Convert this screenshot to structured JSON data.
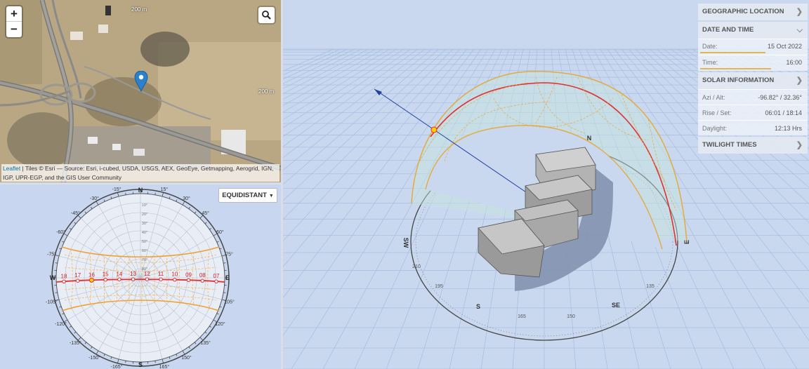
{
  "map": {
    "zoom_in_label": "+",
    "zoom_out_label": "−",
    "scale_labels": [
      "200 m",
      "200 m"
    ],
    "attribution_link": "Leaflet",
    "attribution_text": " | Tiles © Esri — Source: Esri, i-cubed, USDA, USGS, AEX, GeoEye, Getmapping, Aerogrid, IGN, IGP, UPR-EGP, and the GIS User Community",
    "icons": {
      "search": "search-icon",
      "pin": "map-pin-icon"
    }
  },
  "sunpath2d": {
    "projection_button": "EQUIDISTANT",
    "compass": {
      "n": "N",
      "s": "S",
      "e": "E",
      "w": "W"
    },
    "azimuth_ticks_top": [
      "-15°",
      "15°",
      "-30°",
      "30°",
      "-45°",
      "45°",
      "-60°",
      "60°",
      "-75°",
      "75°"
    ],
    "azimuth_ticks_bottom": [
      "-105°",
      "105°",
      "-120°",
      "120°",
      "-135°",
      "135°",
      "-150°",
      "150°",
      "-165°",
      "165°"
    ],
    "altitude_ticks": [
      "80°",
      "70°",
      "60°",
      "50°",
      "40°",
      "30°",
      "20°",
      "10°"
    ],
    "hour_labels": [
      "18",
      "17",
      "16",
      "15",
      "14",
      "13",
      "12",
      "11",
      "10",
      "09",
      "08",
      "07"
    ],
    "colors": {
      "path_today": "#e03030",
      "path_seasonal": "#f0a030",
      "current_sun": "#ffcc00"
    }
  },
  "view3d": {
    "compass_labels": [
      "S",
      "N",
      "E",
      "SE",
      "SW",
      "165",
      "150",
      "195",
      "210",
      "135"
    ]
  },
  "panel": {
    "geo": {
      "title": "GEOGRAPHIC LOCATION"
    },
    "datetime": {
      "title": "DATE AND TIME",
      "date_label": "Date:",
      "date_value": "15 Oct 2022",
      "time_label": "Time:",
      "time_value": "16:00",
      "date_progress": 0.79,
      "time_progress": 0.67
    },
    "solar": {
      "title": "SOLAR INFORMATION",
      "azi_label": "Azi / Alt:",
      "azi_value": "-96.82° / 32.36°",
      "rise_label": "Rise / Set:",
      "rise_value": "06:01 / 18:14",
      "daylight_label": "Daylight:",
      "daylight_value": "12:13 Hrs"
    },
    "twilight": {
      "title": "TWILIGHT TIMES"
    },
    "icons": {
      "expand": "chevron-right-icon",
      "collapse": "chevron-down-icon"
    }
  }
}
